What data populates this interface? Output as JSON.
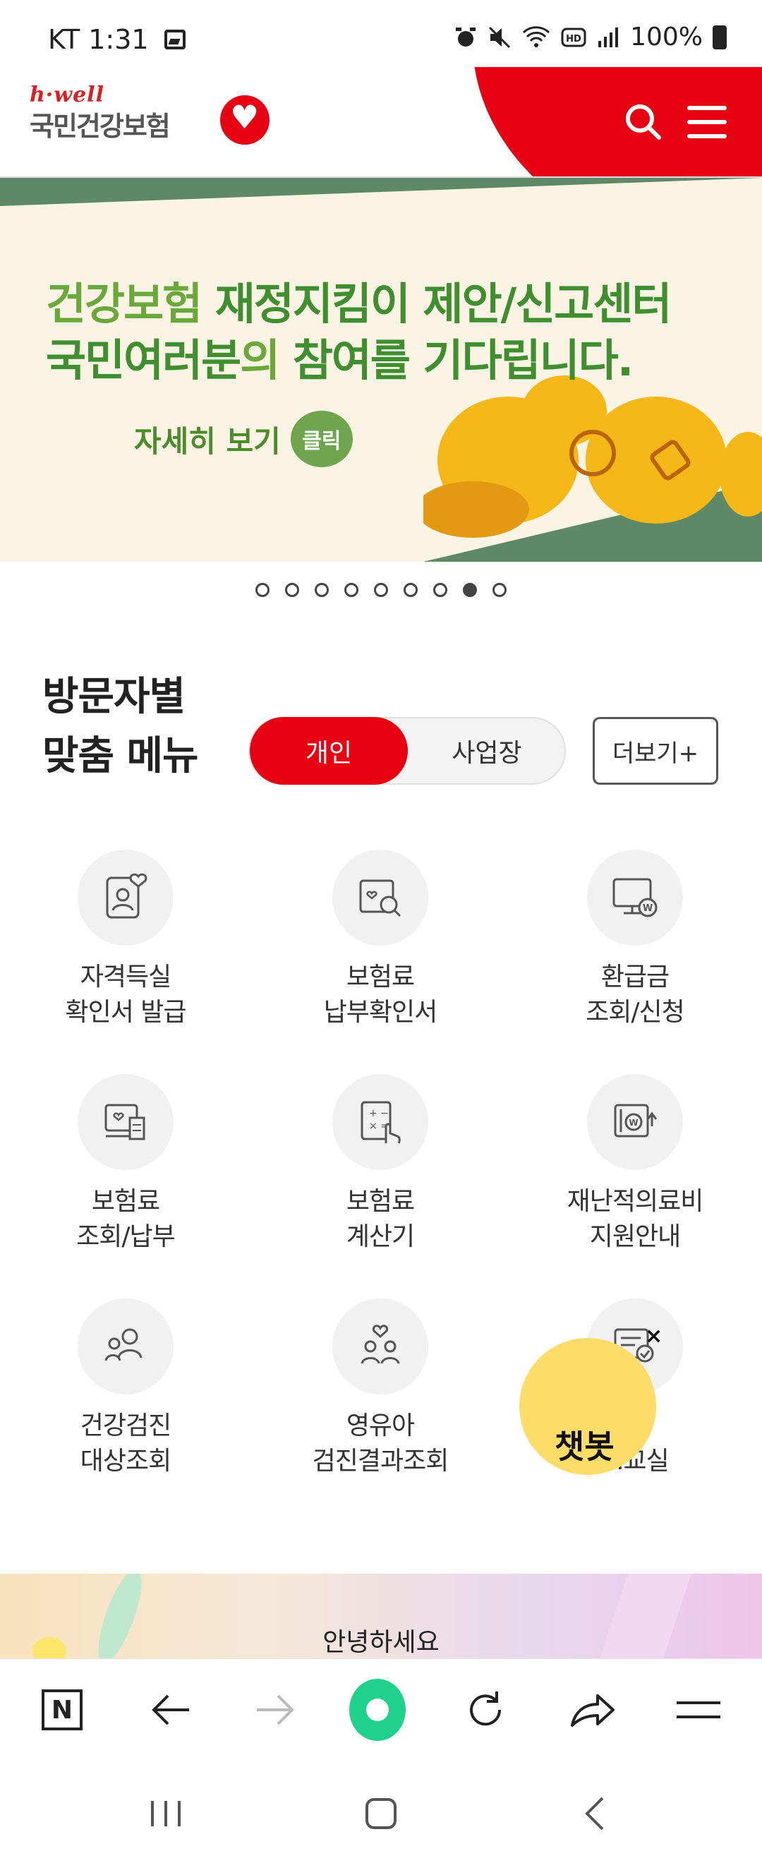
{
  "status_bar": {
    "carrier_time": "KT 1:31",
    "battery_percent": "100%"
  },
  "header": {
    "logo_tagline": "h·well",
    "logo_name": "국민건강보험"
  },
  "banner": {
    "line1_prefix": "건강보험 ",
    "line1_emph": "재정지킴이 제안/신고센터",
    "line2_prefix": "국민여러분",
    "line2_mid": "의 ",
    "line2_emph": "참여를 기다립니다.",
    "cta_text": "자세히 보기",
    "cta_button": "클릭"
  },
  "carousel": {
    "total": 9,
    "active_index": 7
  },
  "visitor_menu": {
    "title_line1": "방문자별",
    "title_line2": "맞춤 메뉴",
    "tab_personal": "개인",
    "tab_business": "사업장",
    "more_button": "더보기+"
  },
  "grid": [
    {
      "label": "자격득실\n확인서 발급",
      "icon": "id-card-heart-icon"
    },
    {
      "label": "보험료\n납부확인서",
      "icon": "document-search-icon"
    },
    {
      "label": "환급금\n조회/신청",
      "icon": "monitor-won-icon"
    },
    {
      "label": "보험료\n조회/납부",
      "icon": "receipt-heart-icon"
    },
    {
      "label": "보험료\n계산기",
      "icon": "calculator-hand-icon"
    },
    {
      "label": "재난적의료비\n지원안내",
      "icon": "card-won-arrow-icon"
    },
    {
      "label": "건강검진\n대상조회",
      "icon": "people-group-icon"
    },
    {
      "label": "영유아\n검진결과조회",
      "icon": "family-heart-icon"
    },
    {
      "label": "...\n...교실",
      "icon": "document-check-icon"
    }
  ],
  "chatbot": {
    "label": "챗봇",
    "close": "×"
  },
  "promo": {
    "text": "안녕하세요"
  },
  "colors": {
    "brand_red": "#e60012",
    "banner_green": "#3f8f30",
    "chatbot_yellow": "#fddc6a",
    "naver_green": "#1fd18a"
  }
}
